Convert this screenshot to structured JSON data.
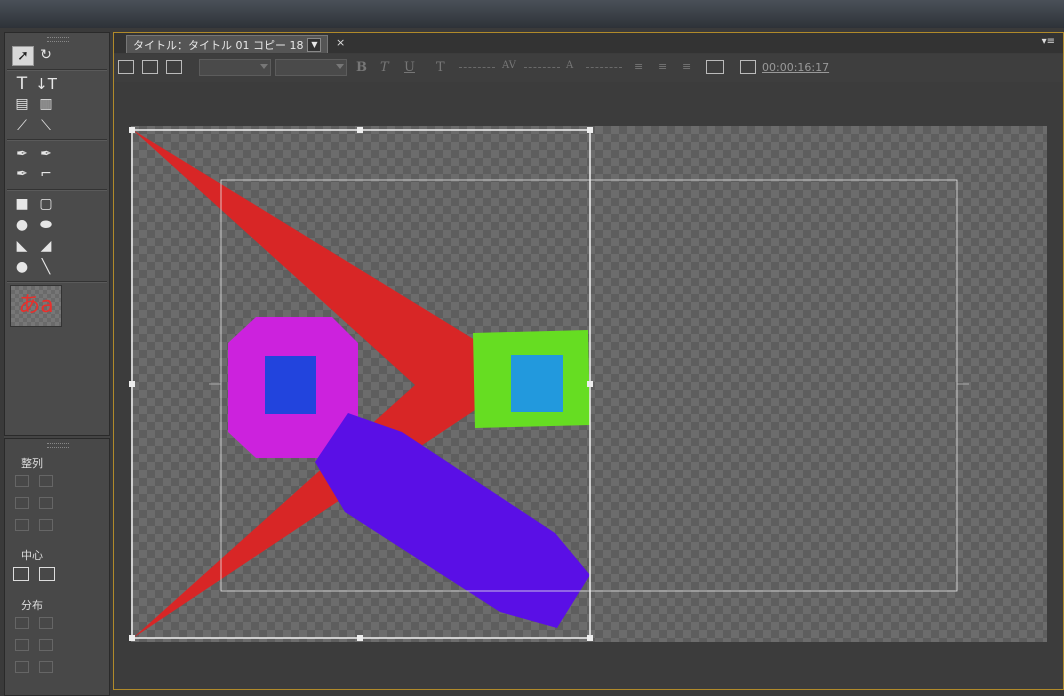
{
  "tab": {
    "title": "タイトル：タイトル 01 コピー 18"
  },
  "toolbar": {
    "timecode": "00:00:16:17",
    "bold": "B",
    "italic": "T",
    "underline": "U"
  },
  "align_panel": {
    "align_label": "整列",
    "center_label": "中心",
    "distribute_label": "分布"
  },
  "style_preview": {
    "text": "あa"
  },
  "icons": {
    "close": "×",
    "panel_menu": "▾≡"
  },
  "colors": {
    "red_shape": "#d82626",
    "magenta_octagon": "#cc22dd",
    "blue_square": "#2244dd",
    "green_square": "#66dd22",
    "cyan_square": "#2299dd",
    "purple_shape": "#5a0fe6",
    "panel_border": "#b08a2a"
  }
}
